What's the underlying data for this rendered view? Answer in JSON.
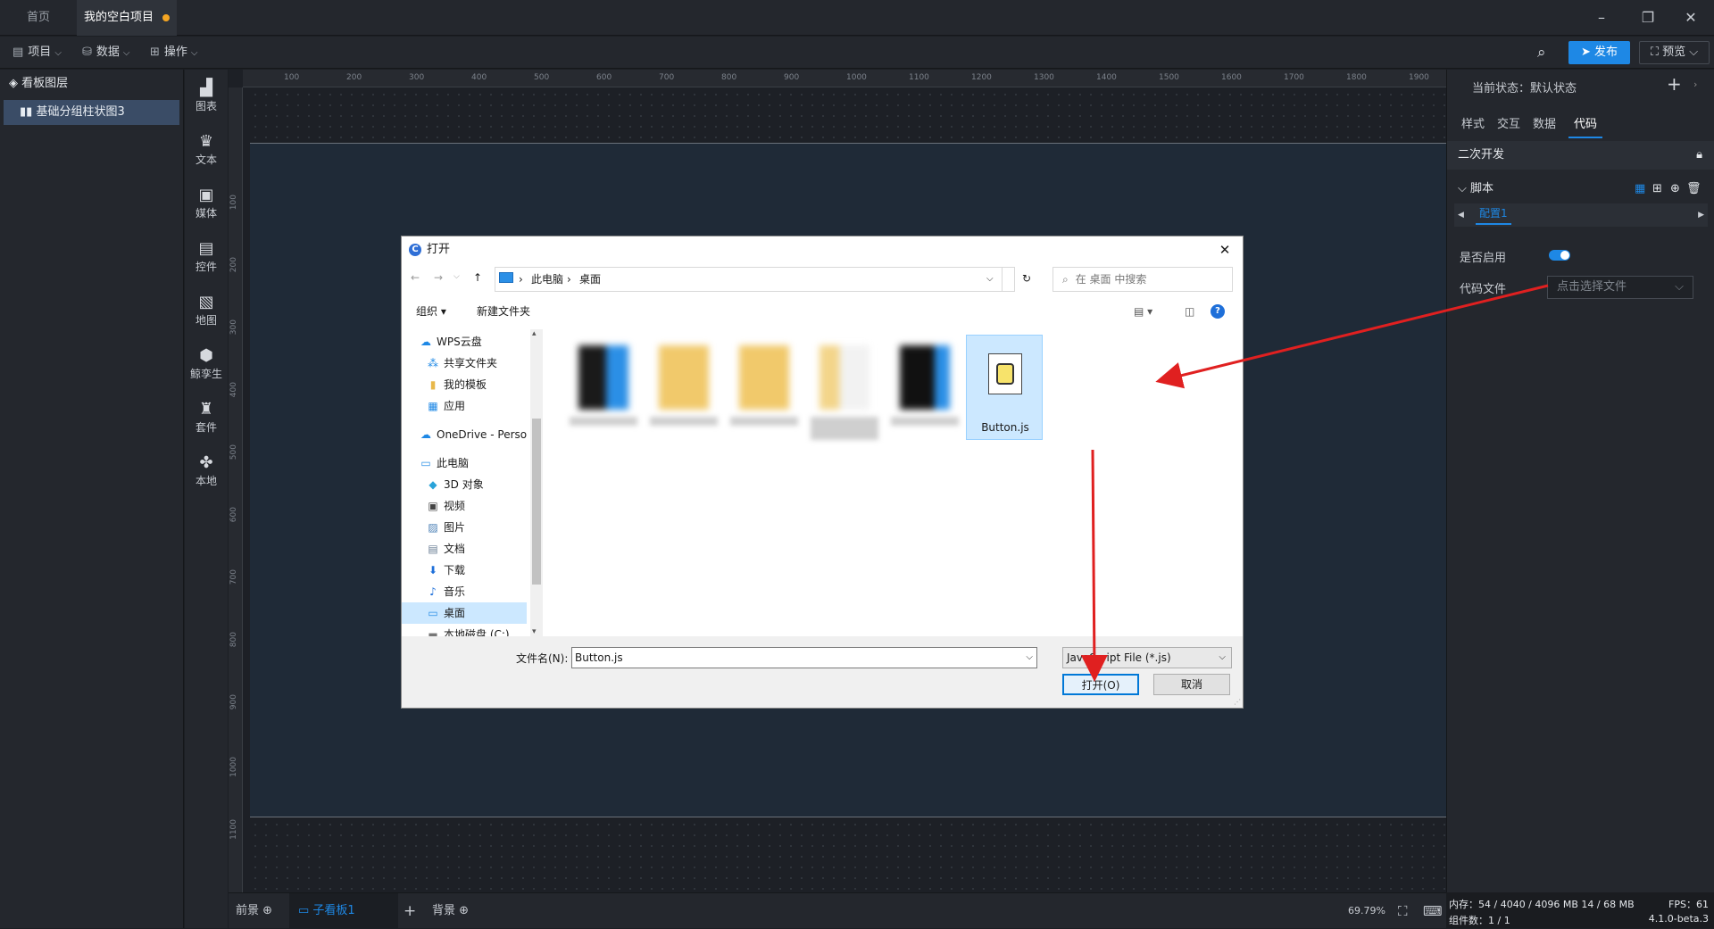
{
  "tabs": {
    "home": "首页",
    "project": "我的空白项目"
  },
  "menu": {
    "project": "项目",
    "data": "数据",
    "operation": "操作",
    "publish": "发布",
    "preview": "预览"
  },
  "layers": {
    "title": "看板图层",
    "items": [
      "基础分组柱状图3"
    ]
  },
  "components": [
    "图表",
    "文本",
    "媒体",
    "控件",
    "地图",
    "鲸孪生",
    "套件",
    "本地"
  ],
  "ruler": {
    "top": [
      "100",
      "200",
      "300",
      "400",
      "500",
      "600",
      "700",
      "800",
      "900",
      "1000",
      "1100",
      "1200",
      "1300",
      "1400",
      "1500",
      "1600",
      "1700",
      "1800",
      "1900"
    ],
    "left": [
      "100",
      "200",
      "300",
      "400",
      "500",
      "600",
      "700",
      "800",
      "900",
      "1000",
      "1100"
    ]
  },
  "bottom": {
    "foreground": "前景",
    "subboard": "子看板1",
    "background": "背景",
    "zoom": "69.79%"
  },
  "right_panel": {
    "state_label": "当前状态：默认状态",
    "tabs": [
      "样式",
      "交互",
      "数据",
      "代码"
    ],
    "section": "二次开发",
    "script": "脚本",
    "config": "配置1",
    "enable_label": "是否启用",
    "code_file_label": "代码文件",
    "code_file_placeholder": "点击选择文件"
  },
  "status": {
    "memory": "内存：54 / 4040 / 4096 MB  14 / 68 MB",
    "fps": "FPS：61",
    "components": "组件数：1 / 1",
    "version": "4.1.0-beta.3"
  },
  "dialog": {
    "title": "打开",
    "path": [
      "此电脑",
      "桌面"
    ],
    "search_placeholder": "在 桌面 中搜索",
    "organize": "组织",
    "new_folder": "新建文件夹",
    "nav": [
      "WPS云盘",
      "共享文件夹",
      "我的模板",
      "应用",
      "OneDrive - Personal",
      "此电脑",
      "3D 对象",
      "视频",
      "图片",
      "文档",
      "下载",
      "音乐",
      "桌面",
      "本地磁盘 (C:)"
    ],
    "selected_file": "Button.js",
    "filename_label": "文件名(N):",
    "filename_value": "Button.js",
    "filetype": "JavaScript File (*.js)",
    "open_button": "打开(O)",
    "cancel_button": "取消"
  },
  "colors": {
    "accent": "#1e88e5",
    "arrow": "#e02020",
    "selection": "#cce8ff"
  }
}
